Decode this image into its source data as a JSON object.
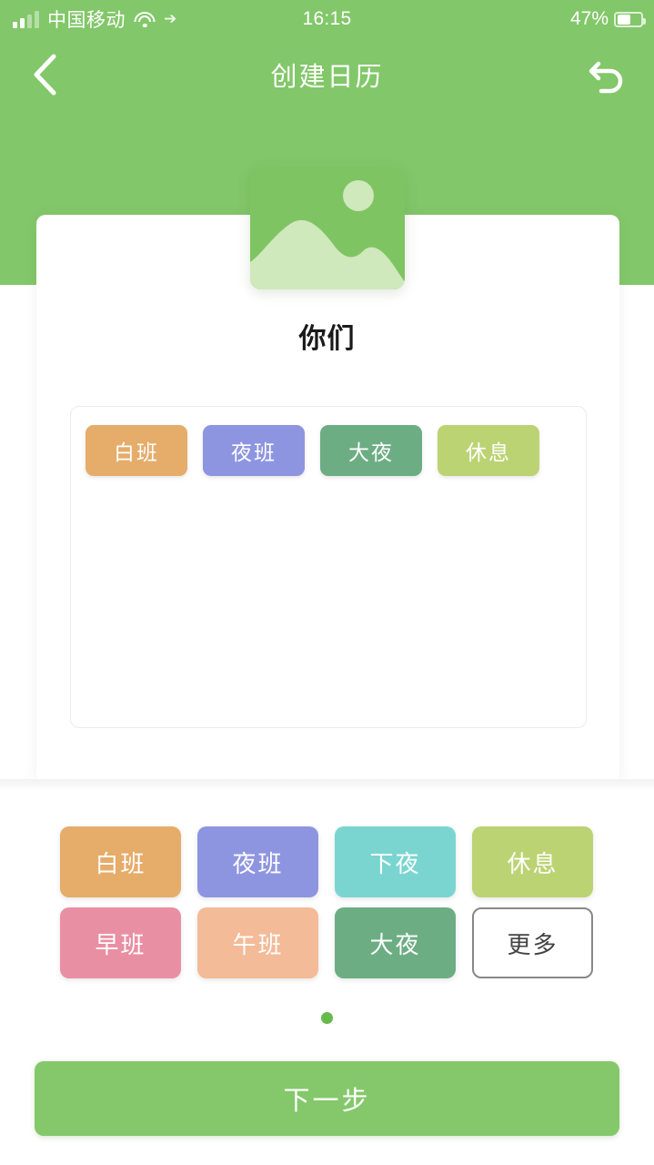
{
  "status_bar": {
    "carrier": "中国移动",
    "time": "16:15",
    "battery_percent": "47%",
    "wifi_icon": "wifi-icon",
    "location_icon": "location-arrow-icon",
    "signal_icon": "signal-bars-icon",
    "battery_icon": "battery-icon"
  },
  "nav": {
    "title": "创建日历",
    "back_icon": "chevron-left-icon",
    "undo_icon": "undo-arrow-icon"
  },
  "cover": {
    "icon": "image-placeholder-icon"
  },
  "card": {
    "title": "你们",
    "selected_shifts": [
      {
        "label": "白班",
        "color": "#e5ac6a"
      },
      {
        "label": "夜班",
        "color": "#8e95e0"
      },
      {
        "label": "大夜",
        "color": "#6dad84"
      },
      {
        "label": "休息",
        "color": "#bcd373"
      }
    ]
  },
  "palette": {
    "chips": [
      {
        "label": "白班",
        "color": "#e5ac6a",
        "style": "filled"
      },
      {
        "label": "夜班",
        "color": "#8e95e0",
        "style": "filled"
      },
      {
        "label": "下夜",
        "color": "#7ad5d0",
        "style": "filled"
      },
      {
        "label": "休息",
        "color": "#bcd373",
        "style": "filled"
      },
      {
        "label": "早班",
        "color": "#e98fa3",
        "style": "filled"
      },
      {
        "label": "午班",
        "color": "#f3bb98",
        "style": "filled"
      },
      {
        "label": "大夜",
        "color": "#6dad84",
        "style": "filled"
      },
      {
        "label": "更多",
        "color": "#ffffff",
        "style": "outline"
      }
    ],
    "page_count": 1,
    "active_page": 0
  },
  "footer": {
    "next_label": "下一步"
  },
  "theme": {
    "header_green": "#82c769",
    "button_green": "#84c86b",
    "dot_green": "#64ba4a"
  }
}
